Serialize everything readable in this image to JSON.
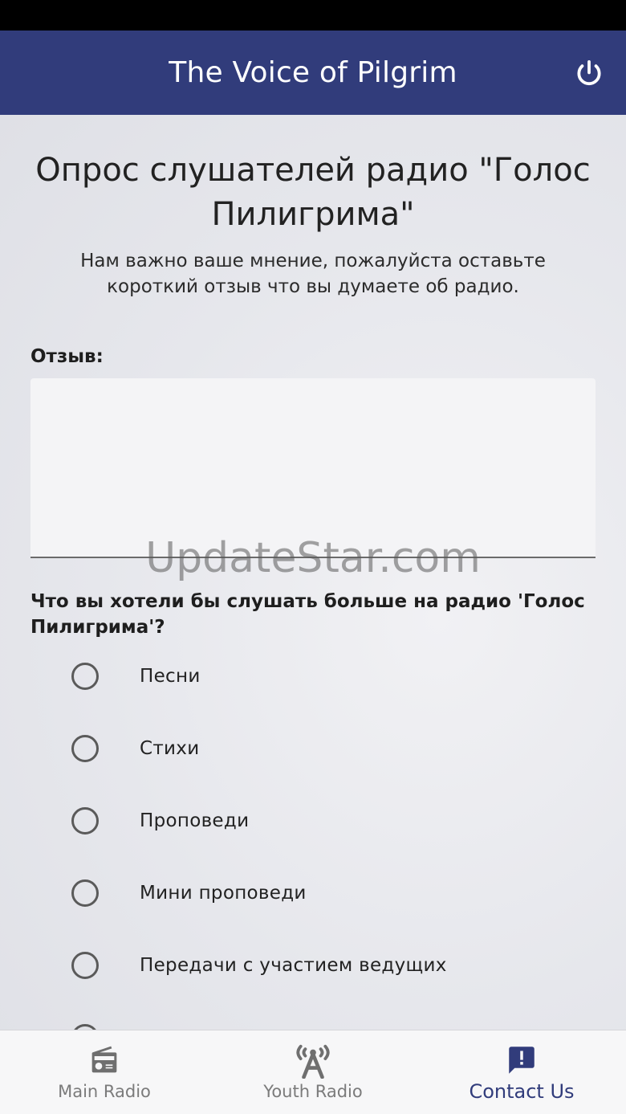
{
  "app": {
    "title": "The Voice of Pilgrim"
  },
  "survey": {
    "title": "Опрос слушателей радио \"Голос Пилигрима\"",
    "subtitle": "Нам важно ваше мнение, пожалуйста оставьте короткий отзыв что вы думаете об радио.",
    "feedback_label": "Отзыв:",
    "feedback_value": "",
    "question": "Что вы хотели бы слушать больше на радио 'Голос Пилигрима'?",
    "options": [
      {
        "label": "Песни",
        "selected": false
      },
      {
        "label": "Стихи",
        "selected": false
      },
      {
        "label": "Проповеди",
        "selected": false
      },
      {
        "label": "Мини проповеди",
        "selected": false
      },
      {
        "label": "Передачи с участием ведущих",
        "selected": false
      }
    ]
  },
  "watermark": "UpdateStar.com",
  "nav": {
    "items": [
      {
        "label": "Main Radio",
        "icon": "radio-icon",
        "active": false
      },
      {
        "label": "Youth Radio",
        "icon": "broadcast-tower-icon",
        "active": false
      },
      {
        "label": "Contact Us",
        "icon": "feedback-icon",
        "active": true
      }
    ]
  },
  "colors": {
    "app_bar": "#313c7b",
    "accent": "#313c7b",
    "nav_inactive": "#7b7b7b"
  }
}
